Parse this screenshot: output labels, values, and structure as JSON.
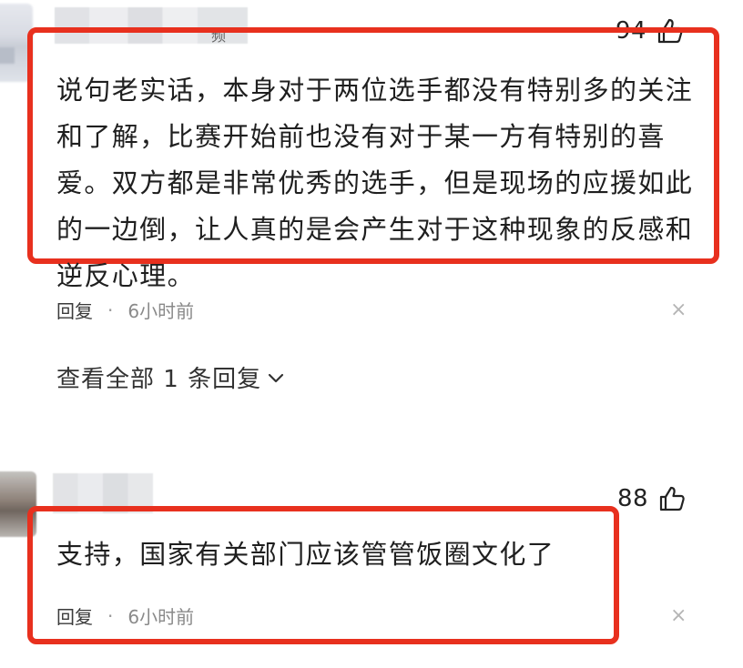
{
  "comments": [
    {
      "username_suffix": "频",
      "likes": "94",
      "text_lines": [
        "说句老实话，本身对于两位选手都没有特别多的关注",
        "和了解，比赛开始前也没有对于某一方有特别的喜",
        "爱。双方都是非常优秀的选手，但是现场的应援如此",
        "的一边倒，让人真的是会产生对于这种现象的反感和",
        "逆反心理。"
      ],
      "reply_label": "回复",
      "separator": "·",
      "time": "6小时前",
      "close": "×",
      "view_replies": "查看全部 1 条回复"
    },
    {
      "likes": "88",
      "text": "支持，国家有关部门应该管管饭圈文化了",
      "reply_label": "回复",
      "separator": "·",
      "time": "6小时前",
      "close": "×"
    }
  ],
  "colors": {
    "highlight": "#e8301e",
    "text": "#1f1f1f",
    "meta": "#8a8a8a"
  },
  "icons": [
    "thumbs-up-icon",
    "chevron-down-icon",
    "close-icon"
  ]
}
